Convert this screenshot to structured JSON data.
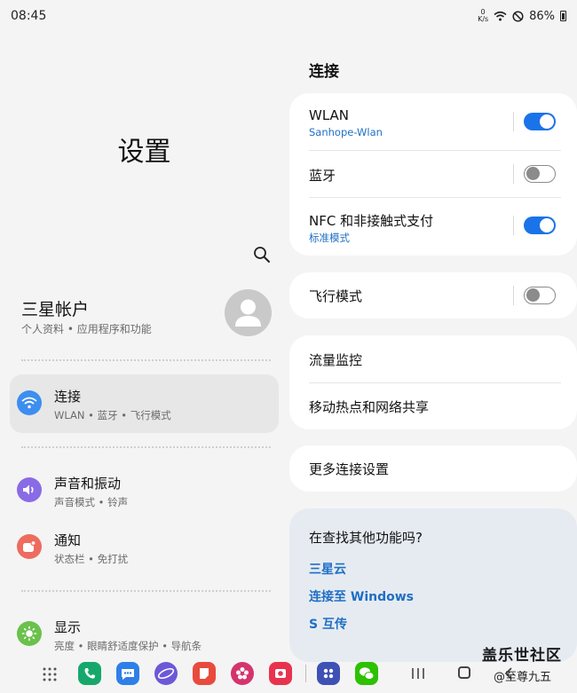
{
  "status": {
    "time": "08:45",
    "speed_top": "0",
    "speed_bottom": "K/s",
    "battery": "86%"
  },
  "left": {
    "title": "设置",
    "account": {
      "name": "三星帐户",
      "sub": "个人资料 • 应用程序和功能"
    },
    "items": [
      {
        "title": "连接",
        "sub": "WLAN • 蓝牙 • 飞行模式",
        "icon": "wifi-icon",
        "color": "#3d8ef0"
      },
      {
        "title": "声音和振动",
        "sub": "声音模式 • 铃声",
        "icon": "speaker-icon",
        "color": "#8a6be6"
      },
      {
        "title": "通知",
        "sub": "状态栏 • 免打扰",
        "icon": "notification-icon",
        "color": "#ee6b5e"
      },
      {
        "title": "显示",
        "sub": "亮度 • 眼睛舒适度保护 • 导航条",
        "icon": "brightness-icon",
        "color": "#6ac14b"
      }
    ]
  },
  "right": {
    "section_title": "连接",
    "wlan": {
      "title": "WLAN",
      "sub": "Sanhope-Wlan",
      "on": true
    },
    "bluetooth": {
      "title": "蓝牙",
      "on": false
    },
    "nfc": {
      "title": "NFC 和非接触式支付",
      "sub": "标准模式",
      "on": true
    },
    "airplane": {
      "title": "飞行模式",
      "on": false
    },
    "data_usage": "流量监控",
    "hotspot": "移动热点和网络共享",
    "more": "更多连接设置",
    "suggest": {
      "title": "在查找其他功能吗?",
      "links": [
        "三星云",
        "连接至 Windows",
        "S 互传"
      ]
    }
  },
  "watermark": {
    "line1": "盖乐世社区",
    "line2": "@至尊九五"
  },
  "colors": {
    "accent": "#1a73e8",
    "link": "#1f6fc4"
  }
}
